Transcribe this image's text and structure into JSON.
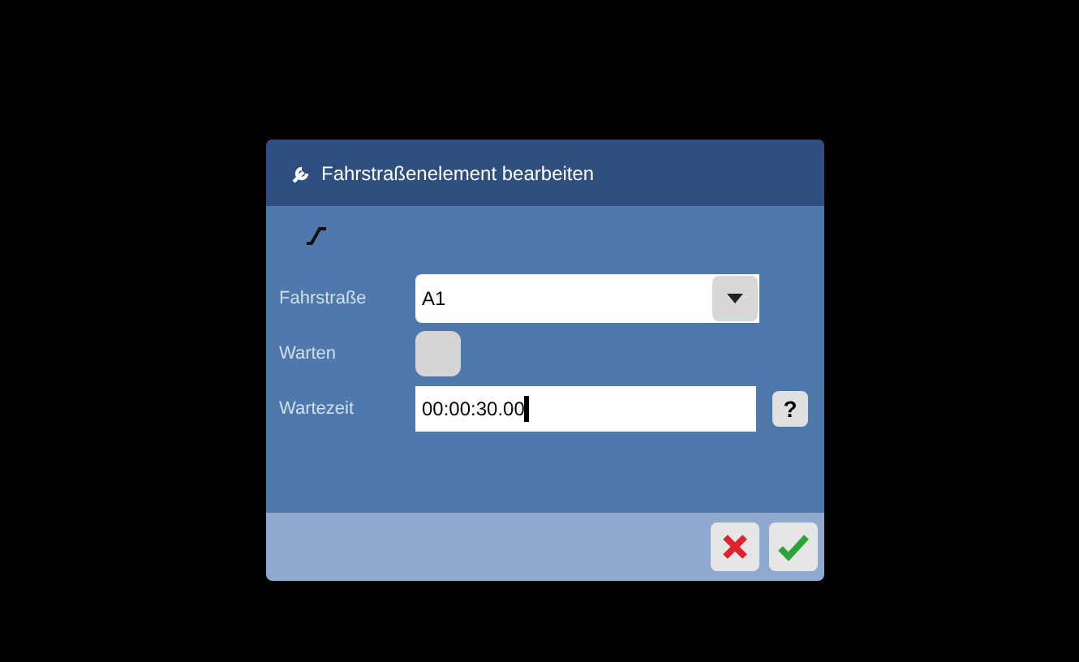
{
  "dialog": {
    "title": "Fahrstraßenelement bearbeiten"
  },
  "fields": [
    {
      "kind": "select",
      "label": "Fahrstraße",
      "value": "A1"
    },
    {
      "kind": "checkbox",
      "label": "Warten",
      "checked": false
    },
    {
      "kind": "text",
      "label": "Wartezeit",
      "value": "00:00:30.00",
      "help": "?"
    }
  ]
}
